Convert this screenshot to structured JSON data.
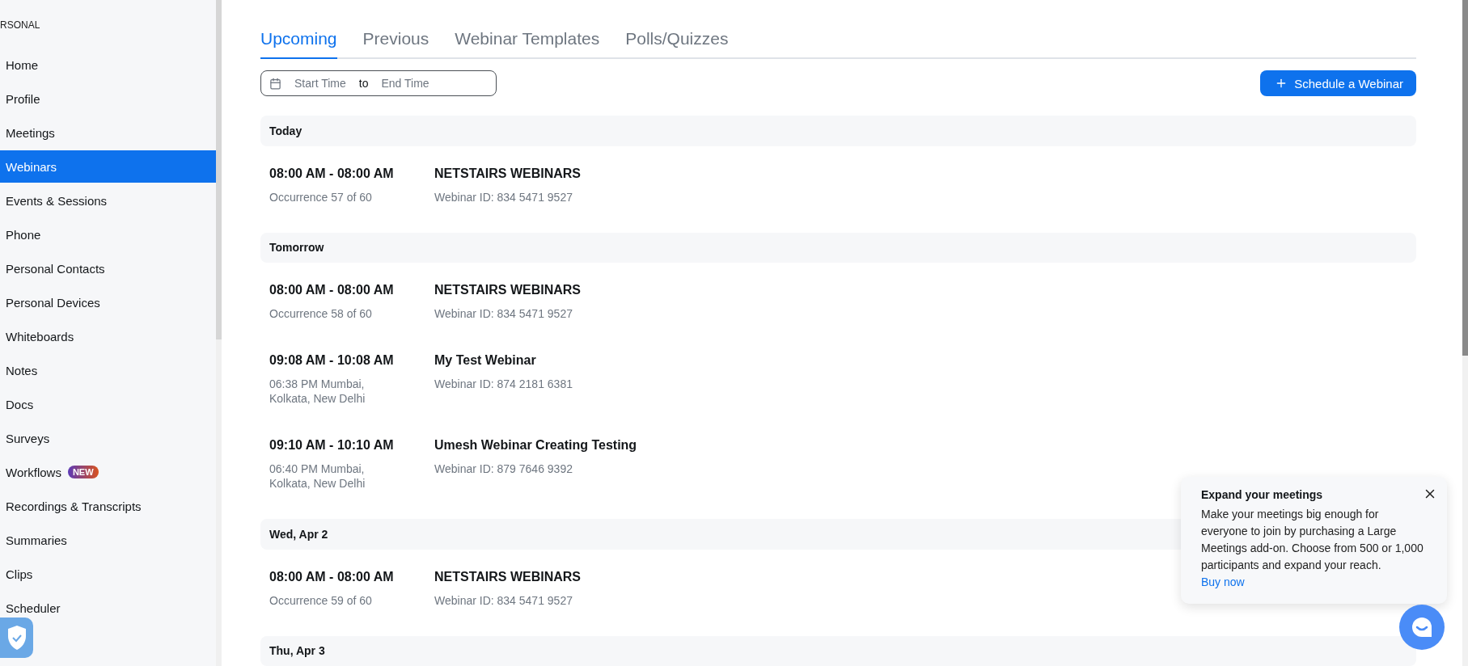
{
  "sidebar": {
    "section_label": "RSONAL",
    "items": [
      {
        "label": "Home",
        "selected": false
      },
      {
        "label": "Profile",
        "selected": false
      },
      {
        "label": "Meetings",
        "selected": false
      },
      {
        "label": "Webinars",
        "selected": true
      },
      {
        "label": "Events & Sessions",
        "selected": false
      },
      {
        "label": "Phone",
        "selected": false
      },
      {
        "label": "Personal Contacts",
        "selected": false
      },
      {
        "label": "Personal Devices",
        "selected": false
      },
      {
        "label": "Whiteboards",
        "selected": false
      },
      {
        "label": "Notes",
        "selected": false
      },
      {
        "label": "Docs",
        "selected": false
      },
      {
        "label": "Surveys",
        "selected": false
      },
      {
        "label": "Workflows",
        "selected": false,
        "badge": "NEW"
      },
      {
        "label": "Recordings & Transcripts",
        "selected": false
      },
      {
        "label": "Summaries",
        "selected": false
      },
      {
        "label": "Clips",
        "selected": false
      },
      {
        "label": "Scheduler",
        "selected": false
      }
    ]
  },
  "tabs": [
    {
      "label": "Upcoming",
      "selected": true
    },
    {
      "label": "Previous",
      "selected": false
    },
    {
      "label": "Webinar Templates",
      "selected": false
    },
    {
      "label": "Polls/Quizzes",
      "selected": false
    }
  ],
  "filter": {
    "start_placeholder": "Start Time",
    "separator": "to",
    "end_placeholder": "End Time"
  },
  "schedule_button": "Schedule a Webinar",
  "groups": [
    {
      "date": "Today",
      "webinars": [
        {
          "time": "08:00 AM - 08:00 AM",
          "detail": "Occurrence 57 of 60",
          "title": "NETSTAIRS WEBINARS",
          "webinar_id": "Webinar ID: 834 5471 9527"
        }
      ]
    },
    {
      "date": "Tomorrow",
      "webinars": [
        {
          "time": "08:00 AM - 08:00 AM",
          "detail": "Occurrence 58 of 60",
          "title": "NETSTAIRS WEBINARS",
          "webinar_id": "Webinar ID: 834 5471 9527"
        },
        {
          "time": "09:08 AM - 10:08 AM",
          "detail": "06:38 PM Mumbai, Kolkata, New Delhi",
          "title": "My Test Webinar",
          "webinar_id": "Webinar ID: 874 2181 6381"
        },
        {
          "time": "09:10 AM - 10:10 AM",
          "detail": "06:40 PM Mumbai, Kolkata, New Delhi",
          "title": "Umesh Webinar Creating Testing",
          "webinar_id": "Webinar ID: 879 7646 9392"
        }
      ]
    },
    {
      "date": "Wed, Apr 2",
      "webinars": [
        {
          "time": "08:00 AM - 08:00 AM",
          "detail": "Occurrence 59 of 60",
          "title": "NETSTAIRS WEBINARS",
          "webinar_id": "Webinar ID: 834 5471 9527"
        }
      ]
    },
    {
      "date": "Thu, Apr 3"
    }
  ],
  "promo": {
    "title": "Expand your meetings",
    "body": "Make your meetings big enough for everyone to join by purchasing a Large Meetings add-on. Choose from 500 or 1,000 participants and expand your reach.",
    "link": "Buy now"
  }
}
